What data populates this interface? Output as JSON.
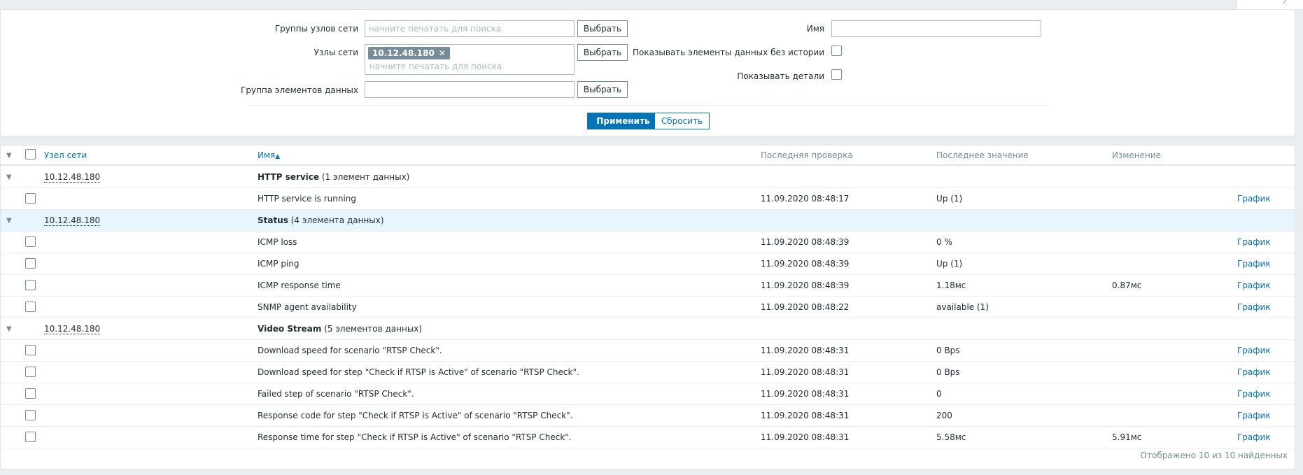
{
  "filter": {
    "host_groups_label": "Группы узлов сети",
    "hosts_label": "Узлы сети",
    "item_group_label": "Группа элементов данных",
    "search_placeholder": "начните печатать для поиска",
    "selected_host": "10.12.48.180",
    "select_label": "Выбрать",
    "name_label": "Имя",
    "name_value": "",
    "show_without_history_label": "Показывать элементы данных без истории",
    "show_details_label": "Показывать детали",
    "apply_label": "Применить",
    "reset_label": "Сбросить"
  },
  "table": {
    "headers": {
      "host": "Узел сети",
      "name": "Имя",
      "last_check": "Последняя проверка",
      "last_value": "Последнее значение",
      "change": "Изменение"
    },
    "sort_indicator": "▲",
    "graph_label": "График",
    "groups": [
      {
        "host": "10.12.48.180",
        "name": "HTTP service",
        "count": "(1 элемент данных)",
        "items": [
          {
            "name": "HTTP service is running",
            "last_check": "11.09.2020 08:48:17",
            "last_value": "Up (1)",
            "change": ""
          }
        ]
      },
      {
        "host": "10.12.48.180",
        "name": "Status",
        "count": "(4 элемента данных)",
        "items": [
          {
            "name": "ICMP loss",
            "last_check": "11.09.2020 08:48:39",
            "last_value": "0 %",
            "change": ""
          },
          {
            "name": "ICMP ping",
            "last_check": "11.09.2020 08:48:39",
            "last_value": "Up (1)",
            "change": ""
          },
          {
            "name": "ICMP response time",
            "last_check": "11.09.2020 08:48:39",
            "last_value": "1.18мс",
            "change": "0.87мс"
          },
          {
            "name": "SNMP agent availability",
            "last_check": "11.09.2020 08:48:22",
            "last_value": "available (1)",
            "change": ""
          }
        ]
      },
      {
        "host": "10.12.48.180",
        "name": "Video Stream",
        "count": "(5 элементов данных)",
        "items": [
          {
            "name": "Download speed for scenario \"RTSP Check\".",
            "last_check": "11.09.2020 08:48:31",
            "last_value": "0 Bps",
            "change": ""
          },
          {
            "name": "Download speed for step \"Check if RTSP is Active\" of scenario \"RTSP Check\".",
            "last_check": "11.09.2020 08:48:31",
            "last_value": "0 Bps",
            "change": ""
          },
          {
            "name": "Failed step of scenario \"RTSP Check\".",
            "last_check": "11.09.2020 08:48:31",
            "last_value": "0",
            "change": ""
          },
          {
            "name": "Response code for step \"Check if RTSP is Active\" of scenario \"RTSP Check\".",
            "last_check": "11.09.2020 08:48:31",
            "last_value": "200",
            "change": ""
          },
          {
            "name": "Response time for step \"Check if RTSP is Active\" of scenario \"RTSP Check\".",
            "last_check": "11.09.2020 08:48:31",
            "last_value": "5.58мс",
            "change": "5.91мс"
          }
        ]
      }
    ],
    "footer": "Отображено 10 из 10 найденных"
  },
  "colors": {
    "link": "#0275b8",
    "muted": "#768d99",
    "highlight_row": "#e8f5ff"
  }
}
